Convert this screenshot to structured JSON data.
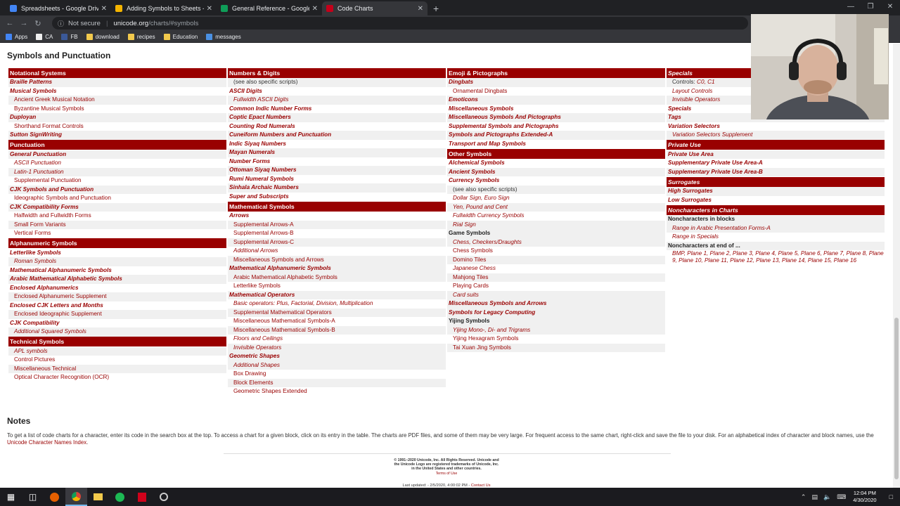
{
  "browser": {
    "tabs": [
      {
        "title": "Spreadsheets - Google Drive",
        "color": "#4285f4",
        "active": false
      },
      {
        "title": "Adding Symbols to Sheets - Goo",
        "color": "#f4b400",
        "active": false
      },
      {
        "title": "General Reference - Google She",
        "color": "#0f9d58",
        "active": false
      },
      {
        "title": "Code Charts",
        "color": "#c4001a",
        "active": true
      }
    ],
    "security_label": "Not secure",
    "url_host": "unicode.org",
    "url_path": "/charts/#symbols",
    "bookmarks": [
      {
        "label": "Apps",
        "color": "#4285f4"
      },
      {
        "label": "CA",
        "color": "#eeeeee"
      },
      {
        "label": "FB",
        "color": "#3b5998"
      },
      {
        "label": "download",
        "color": "#f2c94c"
      },
      {
        "label": "recipes",
        "color": "#f2c94c"
      },
      {
        "label": "Education",
        "color": "#f2c94c"
      },
      {
        "label": "messages",
        "color": "#4a90e2"
      }
    ]
  },
  "page": {
    "title": "Symbols and Punctuation",
    "columns": [
      [
        {
          "t": "Notational Systems",
          "k": "hdr"
        },
        {
          "t": "Braille Patterns",
          "k": "l1"
        },
        {
          "t": "Musical Symbols",
          "k": "l1"
        },
        {
          "t": "Ancient Greek Musical Notation",
          "k": "l2"
        },
        {
          "t": "Byzantine Musical Symbols",
          "k": "l2"
        },
        {
          "t": "Duployan",
          "k": "l1"
        },
        {
          "t": "Shorthand Format Controls",
          "k": "l2"
        },
        {
          "t": "Sutton SignWriting",
          "k": "l1"
        },
        {
          "t": "Punctuation",
          "k": "hdr"
        },
        {
          "t": "General Punctuation",
          "k": "l1"
        },
        {
          "t": "ASCII Punctuation",
          "k": "l2i"
        },
        {
          "t": "Latin-1 Punctuation",
          "k": "l2i"
        },
        {
          "t": "Supplemental Punctuation",
          "k": "l2"
        },
        {
          "t": "CJK Symbols and Punctuation",
          "k": "l1"
        },
        {
          "t": "Ideographic Symbols and Punctuation",
          "k": "l2"
        },
        {
          "t": "CJK Compatibility Forms",
          "k": "l1"
        },
        {
          "t": "Halfwidth and Fullwidth Forms",
          "k": "l2"
        },
        {
          "t": "Small Form Variants",
          "k": "l2"
        },
        {
          "t": "Vertical Forms",
          "k": "l2"
        },
        {
          "t": "Alphanumeric Symbols",
          "k": "hdr"
        },
        {
          "t": "Letterlike Symbols",
          "k": "l1"
        },
        {
          "t": "Roman Symbols",
          "k": "l2i"
        },
        {
          "t": "Mathematical Alphanumeric Symbols",
          "k": "l1"
        },
        {
          "t": "Arabic Mathematical Alphabetic Symbols",
          "k": "l1"
        },
        {
          "t": "Enclosed Alphanumerics",
          "k": "l1"
        },
        {
          "t": "Enclosed Alphanumeric Supplement",
          "k": "l2"
        },
        {
          "t": "Enclosed CJK Letters and Months",
          "k": "l1"
        },
        {
          "t": "Enclosed Ideographic Supplement",
          "k": "l2"
        },
        {
          "t": "CJK Compatibility",
          "k": "l1"
        },
        {
          "t": "Additional Squared Symbols",
          "k": "l2i"
        },
        {
          "t": "Technical Symbols",
          "k": "hdr"
        },
        {
          "t": "APL symbols",
          "k": "l2i"
        },
        {
          "t": "Control Pictures",
          "k": "l2"
        },
        {
          "t": "Miscellaneous Technical",
          "k": "l2"
        },
        {
          "t": "Optical Character Recognition (OCR)",
          "k": "l2"
        }
      ],
      [
        {
          "t": "Numbers & Digits",
          "k": "hdr"
        },
        {
          "t": "(see also specific scripts)",
          "k": "l2p"
        },
        {
          "t": "ASCII Digits",
          "k": "l1"
        },
        {
          "t": "Fullwidth ASCII Digits",
          "k": "l2i"
        },
        {
          "t": "Common Indic Number Forms",
          "k": "l1"
        },
        {
          "t": "Coptic Epact Numbers",
          "k": "l1"
        },
        {
          "t": "Counting Rod Numerals",
          "k": "l1"
        },
        {
          "t": "Cuneiform Numbers and Punctuation",
          "k": "l1"
        },
        {
          "t": "Indic Siyaq Numbers",
          "k": "l1"
        },
        {
          "t": "Mayan Numerals",
          "k": "l1"
        },
        {
          "t": "Number Forms",
          "k": "l1"
        },
        {
          "t": "Ottoman Siyaq Numbers",
          "k": "l1"
        },
        {
          "t": "Rumi Numeral Symbols",
          "k": "l1"
        },
        {
          "t": "Sinhala Archaic Numbers",
          "k": "l1"
        },
        {
          "t": "Super and Subscripts",
          "k": "l1"
        },
        {
          "t": "Mathematical Symbols",
          "k": "hdr"
        },
        {
          "t": "Arrows",
          "k": "l1"
        },
        {
          "t": "Supplemental Arrows-A",
          "k": "l2"
        },
        {
          "t": "Supplemental Arrows-B",
          "k": "l2"
        },
        {
          "t": "Supplemental Arrows-C",
          "k": "l2"
        },
        {
          "t": "Additional Arrows",
          "k": "l2i"
        },
        {
          "t": "Miscellaneous Symbols and Arrows",
          "k": "l2"
        },
        {
          "t": "Mathematical Alphanumeric Symbols",
          "k": "l1s"
        },
        {
          "t": "Arabic Mathematical Alphabetic Symbols",
          "k": "l2"
        },
        {
          "t": "Letterlike Symbols",
          "k": "l2"
        },
        {
          "t": "Mathematical Operators",
          "k": "l1s"
        },
        {
          "t": "Basic operators: Plus, Factorial, Division, Multiplication",
          "k": "l2i"
        },
        {
          "t": "Supplemental Mathematical Operators",
          "k": "l2"
        },
        {
          "t": "Miscellaneous Mathematical Symbols-A",
          "k": "l2"
        },
        {
          "t": "Miscellaneous Mathematical Symbols-B",
          "k": "l2"
        },
        {
          "t": "Floors and Ceilings",
          "k": "l2i"
        },
        {
          "t": "Invisible Operators",
          "k": "l2i"
        },
        {
          "t": "Geometric Shapes",
          "k": "l1s"
        },
        {
          "t": "Additional Shapes",
          "k": "l2i"
        },
        {
          "t": "Box Drawing",
          "k": "l2"
        },
        {
          "t": "Block Elements",
          "k": "l2"
        },
        {
          "t": "Geometric Shapes Extended",
          "k": "l2"
        }
      ],
      [
        {
          "t": "Emoji & Pictographs",
          "k": "hdr"
        },
        {
          "t": "Dingbats",
          "k": "l1"
        },
        {
          "t": "Ornamental Dingbats",
          "k": "l2"
        },
        {
          "t": "Emoticons",
          "k": "l1"
        },
        {
          "t": "Miscellaneous Symbols",
          "k": "l1"
        },
        {
          "t": "Miscellaneous Symbols And Pictographs",
          "k": "l1"
        },
        {
          "t": "Supplemental Symbols and Pictographs",
          "k": "l1"
        },
        {
          "t": "Symbols and Pictographs Extended-A",
          "k": "l1"
        },
        {
          "t": "Transport and Map Symbols",
          "k": "l1"
        },
        {
          "t": "Other Symbols",
          "k": "hdr"
        },
        {
          "t": "Alchemical Symbols",
          "k": "l1"
        },
        {
          "t": "Ancient Symbols",
          "k": "l1"
        },
        {
          "t": "Currency Symbols",
          "k": "l1"
        },
        {
          "t": "(see also specific scripts)",
          "k": "l2p"
        },
        {
          "t": "Dollar Sign, Euro Sign",
          "k": "l2i"
        },
        {
          "t": "Yen, Pound and Cent",
          "k": "l2i"
        },
        {
          "t": "Fullwidth Currency Symbols",
          "k": "l2i"
        },
        {
          "t": "Rial Sign",
          "k": "l2i"
        },
        {
          "t": "Game Symbols",
          "k": "l1ps"
        },
        {
          "t": "Chess, Checkers/Draughts",
          "k": "l2i"
        },
        {
          "t": "Chess Symbols",
          "k": "l2"
        },
        {
          "t": "Domino Tiles",
          "k": "l2"
        },
        {
          "t": "Japanese Chess",
          "k": "l2i"
        },
        {
          "t": "Mahjong Tiles",
          "k": "l2"
        },
        {
          "t": "Playing Cards",
          "k": "l2"
        },
        {
          "t": "Card suits",
          "k": "l2i"
        },
        {
          "t": "Miscellaneous Symbols and Arrows",
          "k": "l1s"
        },
        {
          "t": "Symbols for Legacy Computing",
          "k": "l1"
        },
        {
          "t": "Yijing Symbols",
          "k": "l1ps"
        },
        {
          "t": "Yijing Mono-, Di- and Trigrams",
          "k": "l2i"
        },
        {
          "t": "Yijing Hexagram Symbols",
          "k": "l2"
        },
        {
          "t": "Tai Xuan Jing Symbols",
          "k": "l2"
        }
      ],
      [
        {
          "t": "Specials",
          "k": "hdri"
        },
        {
          "t": "Controls: C0, C1",
          "k": "l2ctrl"
        },
        {
          "t": "Layout Controls",
          "k": "l2i"
        },
        {
          "t": "Invisible Operators",
          "k": "l2i"
        },
        {
          "t": "Specials",
          "k": "l1"
        },
        {
          "t": "Tags",
          "k": "l1"
        },
        {
          "t": "Variation Selectors",
          "k": "l1"
        },
        {
          "t": "Variation Selectors Supplement",
          "k": "l2i"
        },
        {
          "t": "Private Use",
          "k": "hdri"
        },
        {
          "t": "Private Use Area",
          "k": "l1"
        },
        {
          "t": "Supplementary Private Use Area-A",
          "k": "l1"
        },
        {
          "t": "Supplementary Private Use Area-B",
          "k": "l1"
        },
        {
          "t": "Surrogates",
          "k": "hdri"
        },
        {
          "t": "High Surrogates",
          "k": "l1"
        },
        {
          "t": "Low Surrogates",
          "k": "l1"
        },
        {
          "t": "Noncharacters in Charts",
          "k": "hdri"
        },
        {
          "t": "Noncharacters in blocks",
          "k": "l1ps"
        },
        {
          "t": "Range in Arabic Presentation Forms-A",
          "k": "l2i"
        },
        {
          "t": "Range in Specials",
          "k": "l2i"
        },
        {
          "t": "Noncharacters at end of ...",
          "k": "l1ps"
        },
        {
          "t": "BMP, Plane 1, Plane 2, Plane 3, Plane 4, Plane 5, Plane 6, Plane 7, Plane 8, Plane 9, Plane 10, Plane 11, Plane 12, Plane 13, Plane 14, Plane 15, Plane 16",
          "k": "l2b"
        }
      ]
    ],
    "controls_prefix": "Controls: ",
    "controls_link": "C0, C1",
    "notes_title": "Notes",
    "notes_text": "To get a list of code charts for a character, enter its code in the search box at the top. To access a chart for a given block, click on its entry in the table. The charts are PDF files, and some of them may be very large. For frequent access to the same chart, right-click and save the file to your disk. For an alphabetical index of character and block names, use the ",
    "notes_link": "Unicode Character Names Index",
    "notes_end": ".",
    "copyright": "© 1991–2020 Unicode, Inc. All Rights Reserved. Unicode and the Unicode Logo are registered trademarks of Unicode, Inc. in the United States and other countries.",
    "terms": "Terms of Use",
    "last_updated": "Last updated: - 2/5/2020, 4:00:02 PM - ",
    "contact": "Contact Us"
  },
  "taskbar": {
    "time": "12:04 PM",
    "date": "4/30/2020"
  }
}
